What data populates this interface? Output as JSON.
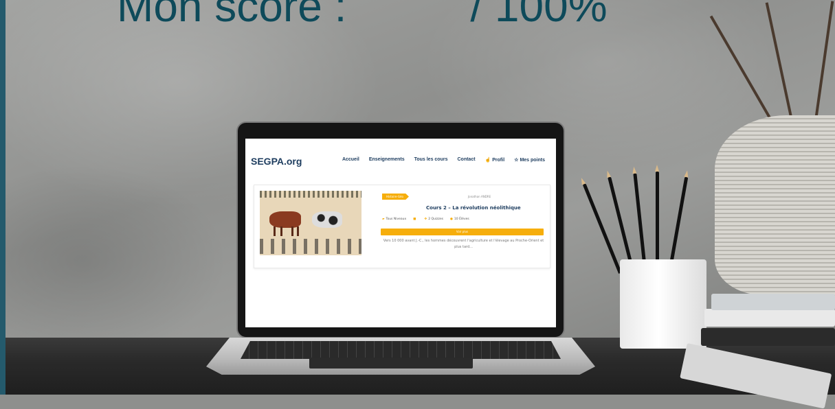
{
  "overlay": {
    "score_label": "Mon score :",
    "score_suffix": "/ 100%"
  },
  "site": {
    "logo": "SEGPA.org",
    "nav": [
      {
        "label": "Accueil"
      },
      {
        "label": "Enseignements"
      },
      {
        "label": "Tous les cours"
      },
      {
        "label": "Contact"
      },
      {
        "label": "Profil",
        "icon": "hand-pointer-icon"
      },
      {
        "label": "Mes points",
        "icon": "star-outline-icon"
      }
    ]
  },
  "course": {
    "category": "Histoire-Géo",
    "author": "Jonathan ANDRE",
    "title": "Cours 2 – La révolution néolithique",
    "level": "Tous Niveaux",
    "quizzes": "2 Quizzes",
    "students": "10 Élèves",
    "cta": "Voir plus",
    "excerpt": "Vers 10 000 avant J.-C., les hommes découvrent l'agriculture et l'élevage au Proche-Orient et plus tard...",
    "image_alt": "fresque-egyptienne"
  },
  "colors": {
    "accent": "#f6ae0c",
    "navy": "#1f3e60",
    "overlay_text": "#0e4a5a",
    "stripe": "#245a6c"
  }
}
